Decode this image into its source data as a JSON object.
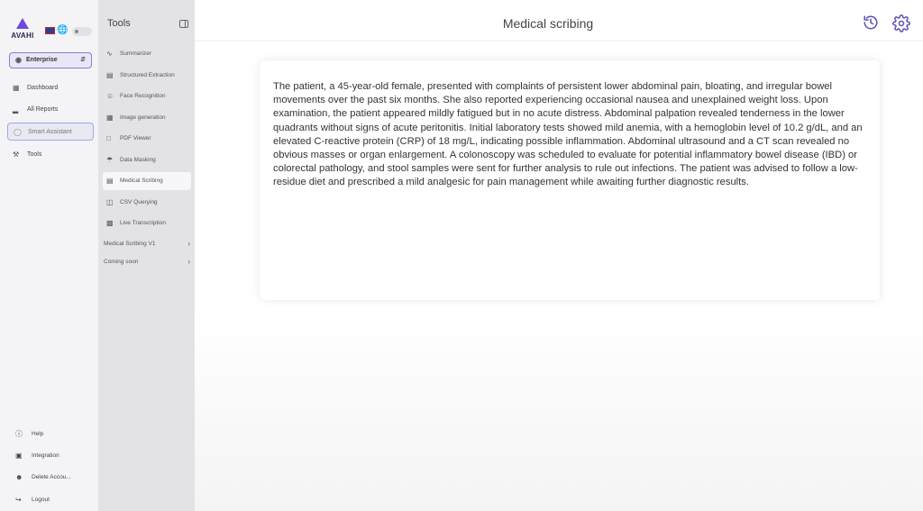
{
  "brand": {
    "name": "AVAHI",
    "accent": "#6f4ad8"
  },
  "plan": {
    "label": "Enterprise"
  },
  "nav": {
    "items": [
      {
        "label": "Dashboard",
        "icon": "grid-icon"
      },
      {
        "label": "All Reports",
        "icon": "bar-chart-icon"
      },
      {
        "label": "Smart Assistant",
        "icon": "chat-bubble-icon",
        "active": true
      },
      {
        "label": "Tools",
        "icon": "wrench-icon"
      }
    ],
    "bottom": [
      {
        "label": "Help",
        "icon": "help-icon"
      },
      {
        "label": "Integration",
        "icon": "integration-icon"
      },
      {
        "label": "Delete Accou...",
        "icon": "delete-user-icon"
      },
      {
        "label": "Logout",
        "icon": "logout-icon"
      }
    ]
  },
  "tools": {
    "title": "Tools",
    "items": [
      {
        "label": "Summarizer",
        "icon": "pulse-icon"
      },
      {
        "label": "Structured Extraction",
        "icon": "document-icon"
      },
      {
        "label": "Face Recognition",
        "icon": "face-icon"
      },
      {
        "label": "Image generation",
        "icon": "image-icon"
      },
      {
        "label": "PDF Viewer",
        "icon": "pdf-icon"
      },
      {
        "label": "Data Masking",
        "icon": "shield-icon"
      },
      {
        "label": "Medical Scribing",
        "icon": "medical-document-icon",
        "active": true
      },
      {
        "label": "CSV Querying",
        "icon": "csv-icon"
      },
      {
        "label": "Live Transcription",
        "icon": "transcription-icon"
      }
    ],
    "groups": [
      {
        "label": "Medical Scribing V1"
      },
      {
        "label": "Coming soon"
      }
    ]
  },
  "main": {
    "title": "Medical scribing",
    "transcript": "The patient, a 45-year-old female, presented with complaints of persistent lower abdominal pain, bloating, and irregular bowel movements over the past six months. She also reported experiencing occasional nausea and unexplained weight loss. Upon examination, the patient appeared mildly fatigued but in no acute distress. Abdominal palpation revealed tenderness in the lower quadrants without signs of acute peritonitis. Initial laboratory tests showed mild anemia, with a hemoglobin level of 10.2 g/dL, and an elevated C-reactive protein (CRP) of 18 mg/L, indicating possible inflammation. Abdominal ultrasound and a CT scan revealed no obvious masses or organ enlargement. A colonoscopy was scheduled to evaluate for potential inflammatory bowel disease (IBD) or colorectal pathology, and stool samples were sent for further analysis to rule out infections. The patient was advised to follow a low-residue diet and prescribed a mild analgesic for pain management while awaiting further diagnostic results."
  }
}
